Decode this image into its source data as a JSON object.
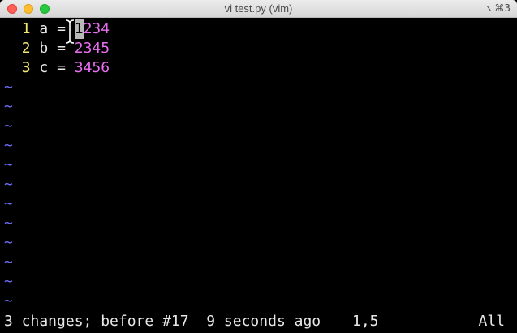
{
  "window": {
    "title": "vi test.py (vim)",
    "shortcut": "⌥⌘3"
  },
  "editor": {
    "lines": [
      {
        "number": "1",
        "var": "a",
        "op": "=",
        "cursor_char": "1",
        "value_rest": "234"
      },
      {
        "number": "2",
        "var": "b",
        "op": "=",
        "value": "2345"
      },
      {
        "number": "3",
        "var": "c",
        "op": "=",
        "value": "3456"
      }
    ],
    "tilde": "~",
    "colors": {
      "line_number": "#f5e870",
      "number_literal": "#e86ef0",
      "tilde": "#6f6ff5",
      "text": "#e8e8e8",
      "background": "#000000"
    }
  },
  "statusline": {
    "message": "3 changes; before #17  9 seconds ago",
    "position": "1,5",
    "scroll": "All"
  }
}
